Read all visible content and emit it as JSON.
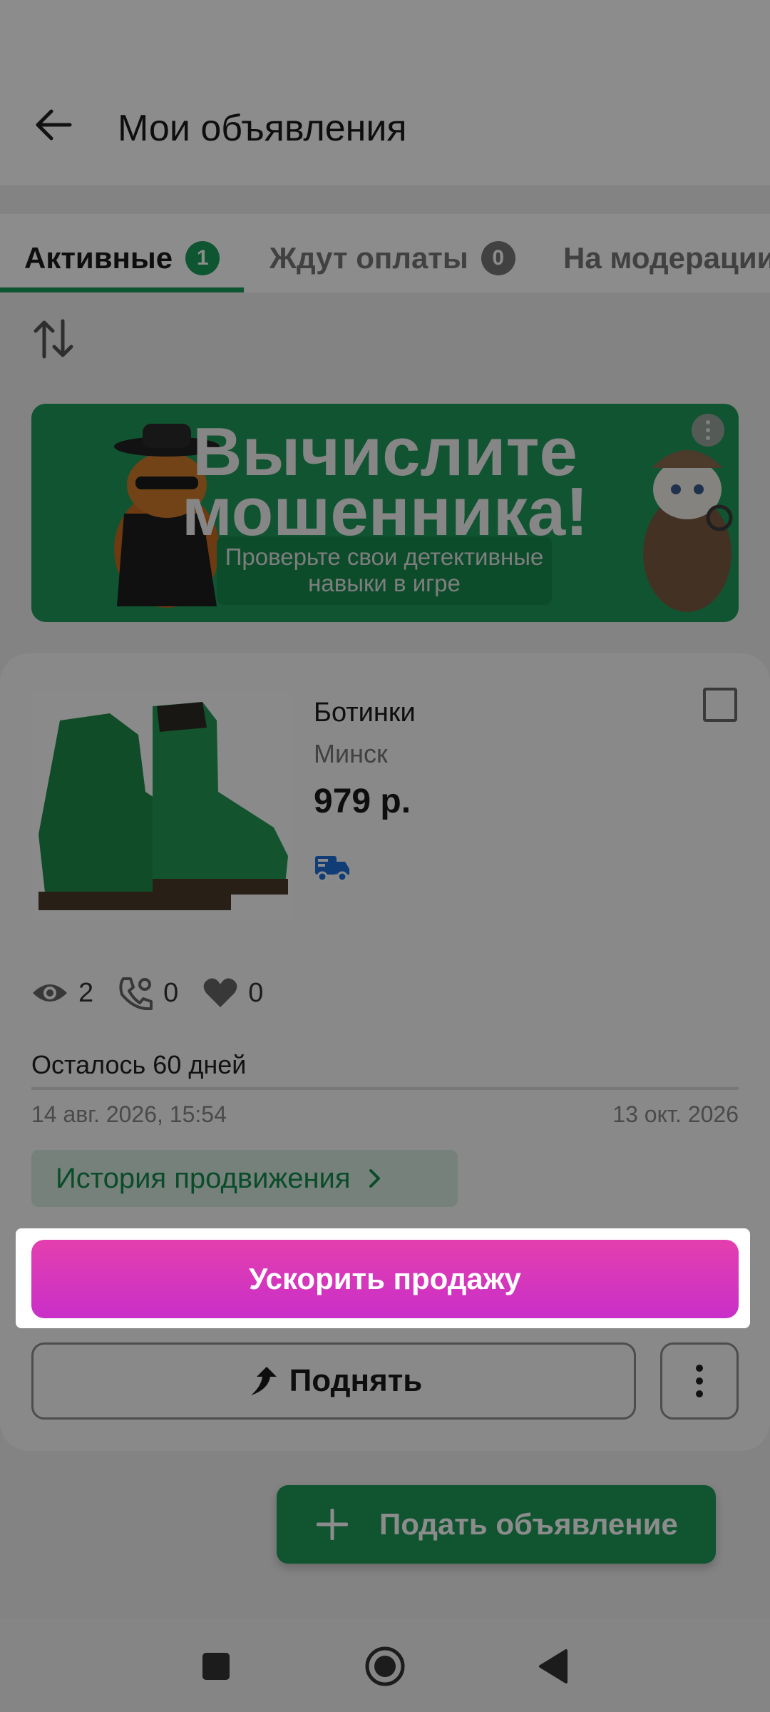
{
  "header": {
    "title": "Мои объявления"
  },
  "tabs": [
    {
      "label": "Активные",
      "count": "1",
      "badge_color": "#1a9b5a"
    },
    {
      "label": "Ждут оплаты",
      "count": "0",
      "badge_color": "#777777"
    },
    {
      "label": "На модерации"
    }
  ],
  "banner": {
    "line1": "Вычислите",
    "line2": "мошенника!",
    "subtitle": "Проверьте свои детективные навыки в игре"
  },
  "ad": {
    "title": "Ботинки",
    "city": "Минск",
    "price": "979 р.",
    "delivery_icon": "truck-icon",
    "stats": {
      "views": "2",
      "calls": "0",
      "favorites": "0"
    },
    "remaining": "Осталось 60 дней",
    "date_start": "14 авг. 2026, 15:54",
    "date_end": "13 окт. 2026",
    "history_label": "История продвижения",
    "boost_label": "Ускорить продажу",
    "raise_label": "Поднять"
  },
  "fab": {
    "label": "Подать объявление"
  },
  "colors": {
    "accent": "#1a9b5a",
    "boost_start": "#e43fae",
    "boost_end": "#c82fc8"
  }
}
